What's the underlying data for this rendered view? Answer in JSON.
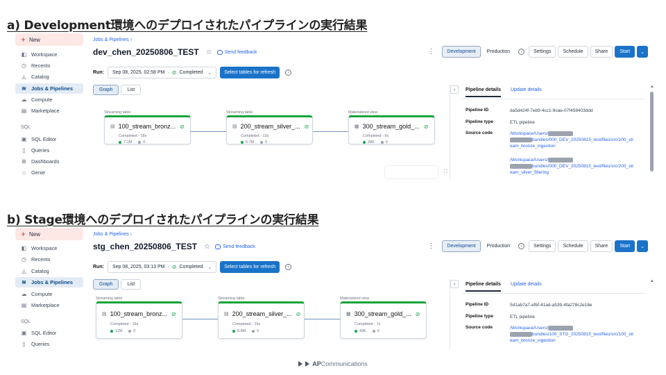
{
  "section_a": {
    "heading": "a) Development環境へのデプロイされたパイプラインの実行結果",
    "sidebar": {
      "new_label": "New",
      "items": [
        {
          "label": "Workspace",
          "icon": "workspace-icon"
        },
        {
          "label": "Recents",
          "icon": "clock-icon"
        },
        {
          "label": "Catalog",
          "icon": "catalog-icon"
        },
        {
          "label": "Jobs & Pipelines",
          "icon": "workflow-icon",
          "active": true
        },
        {
          "label": "Compute",
          "icon": "cloud-icon"
        },
        {
          "label": "Marketplace",
          "icon": "store-icon"
        }
      ],
      "sql_section": "SQL",
      "sql_items": [
        {
          "label": "SQL Editor"
        },
        {
          "label": "Queries"
        },
        {
          "label": "Dashboards"
        },
        {
          "label": "Genie"
        }
      ]
    },
    "breadcrumb": "Jobs & Pipelines  ›",
    "title": "dev_chen_20250806_TEST",
    "feedback": "Send feedback",
    "topbar": {
      "development": "Development",
      "production": "Production",
      "settings": "Settings",
      "schedule": "Schedule",
      "share": "Share",
      "start": "Start"
    },
    "run": {
      "label": "Run:",
      "value": "Sep 08, 2025, 02:58 PM",
      "status": "Completed",
      "refresh": "Select tables for refresh"
    },
    "view": {
      "graph": "Graph",
      "list": "List"
    },
    "nodes": [
      {
        "kind": "Streaming table",
        "name": "100_stream_bronz...",
        "status": "Completed - 18s",
        "rows": "7.1M",
        "dropped": "0"
      },
      {
        "kind": "Streaming table",
        "name": "200_stream_silver_...",
        "status": "Completed - 13s",
        "rows": "5.7M",
        "dropped": "0"
      },
      {
        "kind": "Materialized view",
        "name": "300_stream_gold_...",
        "status": "Completed - 6s",
        "rows": "28K",
        "dropped": "0"
      }
    ],
    "panel": {
      "tab_details": "Pipeline details",
      "tab_updates": "Update details",
      "id_label": "Pipeline ID",
      "id_value": "da5d424f-7eb9-4cc1-9cae-07f458403ddd",
      "type_label": "Pipeline type",
      "type_value": "ETL pipeline",
      "source_label": "Source code",
      "source_1a": "/Workspace/Users/",
      "source_1b": "bundles/000_DEV_20250815_test/files/src/100_stream_bronze_ingestion",
      "source_2a": "/Workspace/Users/",
      "source_2b": "bundles/000_DEV_20250815_test/files/src/200_stream_silver_filtering"
    }
  },
  "section_b": {
    "heading": "b) Stage環境へのデプロイされたパイプラインの実行結果",
    "sidebar": {
      "new_label": "New",
      "items": [
        {
          "label": "Workspace"
        },
        {
          "label": "Recents"
        },
        {
          "label": "Catalog"
        },
        {
          "label": "Jobs & Pipelines"
        },
        {
          "label": "Compute"
        },
        {
          "label": "Marketplace"
        }
      ],
      "sql_section": "SQL",
      "sql_items": [
        {
          "label": "SQL Editor"
        },
        {
          "label": "Queries"
        }
      ]
    },
    "breadcrumb": "Jobs & Pipelines  ›",
    "title": "stg_chen_20250806_TEST",
    "feedback": "Send feedback",
    "topbar": {
      "development": "Development",
      "production": "Production",
      "settings": "Settings",
      "schedule": "Schedule",
      "share": "Share",
      "start": "Start"
    },
    "run": {
      "label": "Run:",
      "value": "Sep 08, 2025, 03:13 PM",
      "status": "Completed",
      "refresh": "Select tables for refresh"
    },
    "view": {
      "graph": "Graph",
      "list": "List"
    },
    "nodes": [
      {
        "kind": "Streaming table",
        "name": "100_stream_bronz...",
        "status": "Completed - 19s",
        "rows": "11M",
        "dropped": "0"
      },
      {
        "kind": "Streaming table",
        "name": "200_stream_silver_...",
        "status": "Completed - 16s",
        "rows": "8.8M",
        "dropped": "0"
      },
      {
        "kind": "Materialized view",
        "name": "300_stream_gold_...",
        "status": "Completed - 7s",
        "rows": "43K",
        "dropped": "0"
      }
    ],
    "panel": {
      "tab_details": "Pipeline details",
      "tab_updates": "Update details",
      "id_label": "Pipeline ID",
      "id_value": "5d1ab7a7-efbf-41ad-a539-4fa278c2e18e",
      "type_label": "Pipeline type",
      "type_value": "ETL pipeline",
      "source_label": "Source code",
      "source_1a": "/Workspace/Users/",
      "source_1b": "bundles/100_STG_20250815_test/files/src/100_stream_bronze_ingestion"
    }
  },
  "footer": {
    "brand_prefix": "AP",
    "brand_rest": "Communications"
  },
  "colors": {
    "accent": "#1a73c8",
    "success": "#16a34a",
    "new_bg": "#fde8e6"
  }
}
